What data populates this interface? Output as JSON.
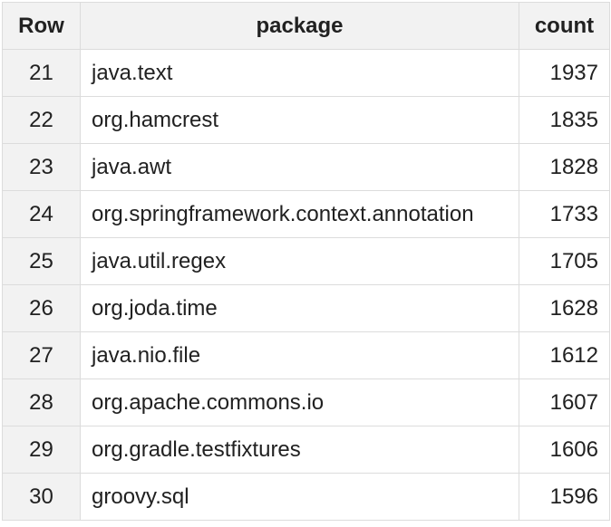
{
  "table": {
    "headers": {
      "row": "Row",
      "package": "package",
      "count": "count"
    },
    "rows": [
      {
        "row": "21",
        "package": "java.text",
        "count": "1937"
      },
      {
        "row": "22",
        "package": "org.hamcrest",
        "count": "1835"
      },
      {
        "row": "23",
        "package": "java.awt",
        "count": "1828"
      },
      {
        "row": "24",
        "package": "org.springframework.context.annotation",
        "count": "1733"
      },
      {
        "row": "25",
        "package": "java.util.regex",
        "count": "1705"
      },
      {
        "row": "26",
        "package": "org.joda.time",
        "count": "1628"
      },
      {
        "row": "27",
        "package": "java.nio.file",
        "count": "1612"
      },
      {
        "row": "28",
        "package": "org.apache.commons.io",
        "count": "1607"
      },
      {
        "row": "29",
        "package": "org.gradle.testfixtures",
        "count": "1606"
      },
      {
        "row": "30",
        "package": "groovy.sql",
        "count": "1596"
      }
    ]
  }
}
